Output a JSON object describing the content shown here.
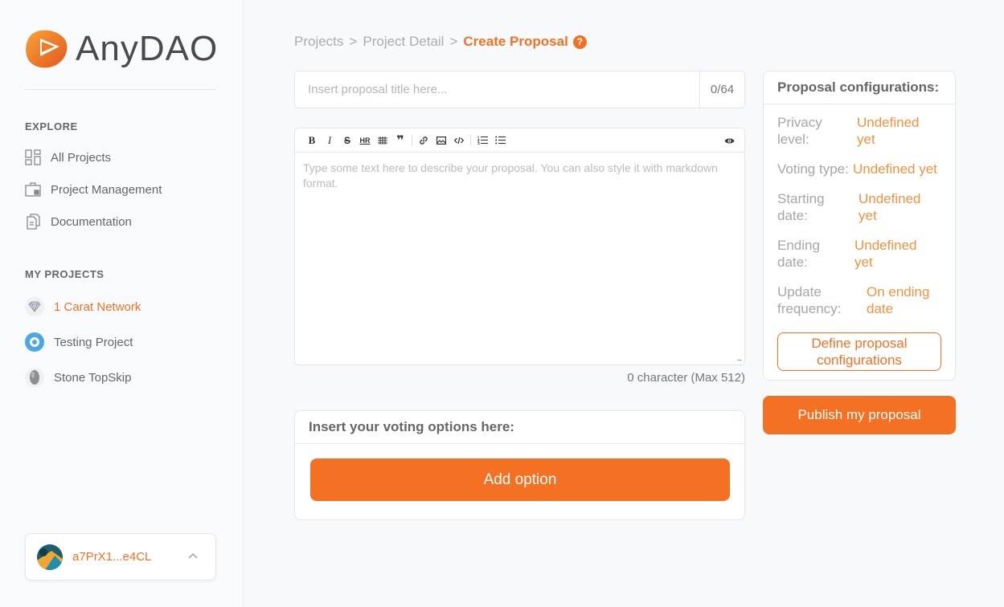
{
  "brand": {
    "name": "AnyDAO",
    "accent": "#f47123"
  },
  "sidebar": {
    "explore_title": "EXPLORE",
    "explore_items": [
      {
        "label": "All Projects",
        "icon": "grid-icon"
      },
      {
        "label": "Project Management",
        "icon": "briefcase-icon"
      },
      {
        "label": "Documentation",
        "icon": "documents-icon"
      }
    ],
    "projects_title": "MY PROJECTS",
    "projects": [
      {
        "label": "1 Carat Network",
        "icon": "diamond-icon",
        "active": true
      },
      {
        "label": "Testing Project",
        "icon": "gear-badge-icon",
        "active": false
      },
      {
        "label": "Stone TopSkip",
        "icon": "stone-icon",
        "active": false
      }
    ],
    "wallet": {
      "address": "a7PrX1...e4CL"
    }
  },
  "breadcrumb": {
    "items": [
      "Projects",
      "Project Detail",
      "Create Proposal"
    ],
    "separator": ">",
    "help": "?"
  },
  "title_input": {
    "placeholder": "Insert proposal title here...",
    "value": "",
    "counter": "0/64"
  },
  "editor": {
    "placeholder": "Type some text here to describe your proposal. You can also style it with markdown format.",
    "resize_handle": "...",
    "toolbar": [
      "bold-icon",
      "italic-icon",
      "strikethrough-icon",
      "hr-icon",
      "table-icon",
      "quote-icon",
      "link-icon",
      "image-icon",
      "code-icon",
      "ordered-list-icon",
      "unordered-list-icon",
      "preview-eye-icon"
    ],
    "toolbar_text": {
      "bold": "B",
      "italic": "I",
      "strike": "S",
      "hr": "HR",
      "quote": "❞"
    },
    "char_count": "0 character (Max 512)"
  },
  "voting": {
    "title": "Insert your voting options here:",
    "add_label": "Add option"
  },
  "config": {
    "title": "Proposal configurations:",
    "rows": [
      {
        "label_l1": "Privacy",
        "label_l2": "level:",
        "value_l1": "Undefined",
        "value_l2": "yet"
      },
      {
        "label_l1": "Voting type:",
        "label_l2": "",
        "value_l1": "Undefined yet",
        "value_l2": ""
      },
      {
        "label_l1": "Starting",
        "label_l2": "date:",
        "value_l1": "Undefined",
        "value_l2": "yet"
      },
      {
        "label_l1": "Ending",
        "label_l2": "date:",
        "value_l1": "Undefined",
        "value_l2": "yet"
      },
      {
        "label_l1": "Update",
        "label_l2": "frequency:",
        "value_l1": "On ending",
        "value_l2": "date"
      }
    ],
    "define_l1": "Define proposal",
    "define_l2": "configurations"
  },
  "publish_label": "Publish my proposal"
}
